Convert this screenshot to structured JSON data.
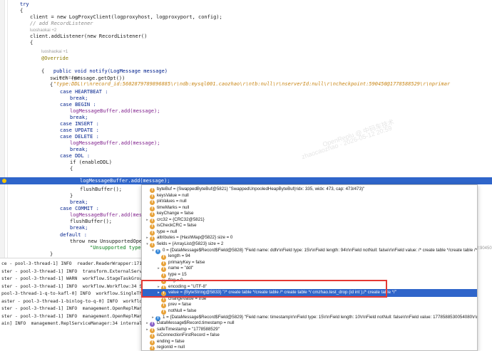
{
  "editor": {
    "try_kw": "try",
    "brace_open": "{",
    "client_line": "client = new LogProxyClient(logproxyhost, logproxyport, config);",
    "comment_add": "// add RecordListener",
    "author_hint": "luoshaokai +2",
    "listener_line": "client.addListener(new RecordListener()",
    "brace2": "{",
    "author_hint2": "luoshaokai +1",
    "override": "@Override",
    "notify_sig": "public void notify(LogMessage message)",
    "inline_message_key": "message:",
    "inline_message_val": "\"type:DDL\\r\\nrecord_id:5602879789896885\\r\\ndb:mysql001.caozhao\\r\\ntb:null\\r\\nserverId:null\\r\\ncheckpoint:590450@1778588529\\r\\nprimar",
    "brace3": "{",
    "switch_line": "switch (message.getOpt())",
    "brace4": "{",
    "case_heartbeat": "case HEARTBEAT :",
    "break1": "break;",
    "case_begin": "case BEGIN :",
    "add1": "logMessageBuffer.add(message);",
    "break2": "break;",
    "case_insert": "case INSERT :",
    "case_update": "case UPDATE :",
    "case_delete": "case DELETE :",
    "add2": "logMessageBuffer.add(message);",
    "break3": "break;",
    "case_ddl": "case DDL :",
    "if_ddl": "if (enableDDL)",
    "brace5": "{",
    "exec_line": "logMessageBuffer.add(message);",
    "flush1": "flushBuffer();",
    "brace6": "}",
    "break4": "break;",
    "case_commit": "case COMMIT :",
    "add3": "logMessageBuffer.add(messa",
    "flush2": "flushBuffer();",
    "break5": "break;",
    "default_line": "default :",
    "throw_line": "throw new UnsupportedOpera",
    "unsupported": "\"Unsupported type:",
    "brace7": "}",
    "side_text": "2:90450"
  },
  "console": {
    "lines": [
      "ce - pool-3-thread-1] INFO  reader.ReaderWrapper:171",
      "ster - pool-3-thread-1] INFO  transform.ExternalService",
      "ster - pool-3-thread-1] WARN  workflow.StageTaskGroup:",
      "ster - pool-3-thread-1] INFO  workflow.Workflow:34 Sta",
      "pool-3-thread-1-q-to-kafl-0] INFO  workflow.SingleThrea",
      "aster - pool-3-thread-1-binlog-to-q-0] INFO  workflow.SingleThre",
      "ster - pool-3-thread-1] INFO  management.OpenReplMana",
      "ster - pool-3-thread-1] INFO  management.OpenReplManag",
      "ain] INFO  management.ReplServiceManager:34 internal/lo"
    ]
  },
  "debugger": {
    "rows": [
      {
        "indent": 0,
        "tw": "",
        "icon": "f",
        "text": "byteBuf = {SwappedByteBuf@5821} \"SwappedUnpooledHeapByteBuf(ridx: 335, widx: 473, cap: 473/473)\""
      },
      {
        "indent": 0,
        "tw": "",
        "icon": "f",
        "text": "keysValue = null"
      },
      {
        "indent": 0,
        "tw": "",
        "icon": "f",
        "text": "pkValues = null"
      },
      {
        "indent": 0,
        "tw": "",
        "icon": "f",
        "text": "timeMarks = null"
      },
      {
        "indent": 0,
        "tw": "",
        "icon": "f",
        "text": "keyChange = false"
      },
      {
        "indent": 0,
        "tw": ">",
        "icon": "f",
        "text": "crc32 = {CRC32@5821}"
      },
      {
        "indent": 0,
        "tw": "",
        "icon": "f",
        "text": "isCheckCRC = false"
      },
      {
        "indent": 0,
        "tw": "",
        "icon": "f",
        "text": "type = null"
      },
      {
        "indent": 0,
        "tw": ">",
        "icon": "f",
        "text": "attributes = {HashMap@5822}  size = 0"
      },
      {
        "indent": 0,
        "tw": "v",
        "icon": "f",
        "text": "fields = {ArrayList@5823}  size = 2"
      },
      {
        "indent": 1,
        "tw": "v",
        "icon": "o",
        "text": "0 = {DataMessage$Record$Field@5828} \"Field name: ddl\\r\\nField type: 15\\r\\nField length: 94\\r\\nField notNull: false\\r\\nField value: /* create table */create table /* create ta"
      },
      {
        "indent": 2,
        "tw": "",
        "icon": "f",
        "text": "length = 94"
      },
      {
        "indent": 2,
        "tw": "",
        "icon": "f",
        "text": "primaryKey = false"
      },
      {
        "indent": 2,
        "tw": ">",
        "icon": "f",
        "text": "name = \"ddl\""
      },
      {
        "indent": 2,
        "tw": "",
        "icon": "f",
        "text": "type = 15"
      },
      {
        "indent": 2,
        "tw": "",
        "icon": "f",
        "text": "flag = 0"
      },
      {
        "indent": 2,
        "tw": ">",
        "icon": "f",
        "text": "encoding = \"UTF-8\""
      },
      {
        "indent": 2,
        "tw": ">",
        "icon": "f",
        "text": "value = {ByteString@5833} \"/* create table */create table /* create table */ cmzhao.test_drop (id int );/* create table */\"",
        "sel": true
      },
      {
        "indent": 2,
        "tw": "",
        "icon": "f",
        "text": "changeValue = true"
      },
      {
        "indent": 2,
        "tw": "",
        "icon": "f",
        "text": "prev = false"
      },
      {
        "indent": 2,
        "tw": "",
        "icon": "f",
        "text": "notNull = false"
      },
      {
        "indent": 1,
        "tw": ">",
        "icon": "o",
        "text": "1 = {DataMessage$Record$Field@5829} \"Field name: timestamp\\r\\nField type: 15\\r\\nField length: 10\\r\\nField notNull: false\\r\\nField value: 1778588530054080\\r\\n\""
      },
      {
        "indent": 0,
        "tw": ">",
        "icon": "p",
        "text": "DataMessage$Record.timestamp = null"
      },
      {
        "indent": 0,
        "tw": ">",
        "icon": "f",
        "text": "safeTimestamp = \"1778588529\""
      },
      {
        "indent": 0,
        "tw": "",
        "icon": "f",
        "text": "isConnectionFirstRecord = false"
      },
      {
        "indent": 0,
        "tw": "",
        "icon": "f",
        "text": "ending = false"
      },
      {
        "indent": 0,
        "tw": "",
        "icon": "f",
        "text": "regionId = null"
      }
    ]
  },
  "watermark": {
    "line1": "OpenReplu @ 中码车技术",
    "line2": "zhaocaozhao · 2026-05-12 20:59"
  },
  "colors": {
    "selection": "#2f65ca",
    "highlight_box": "#e53935",
    "field_icon": "#e8a33b"
  }
}
